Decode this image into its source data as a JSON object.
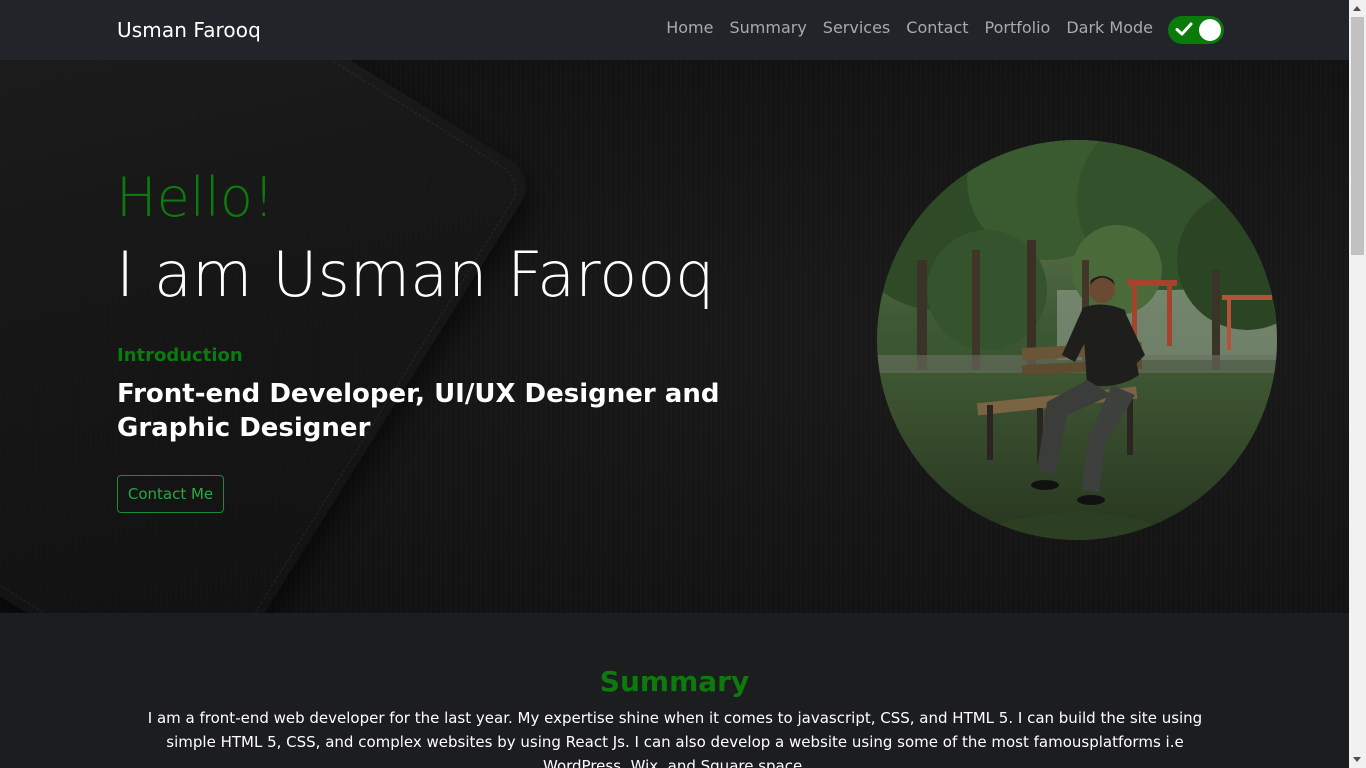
{
  "navbar": {
    "brand": "Usman Farooq",
    "links": [
      "Home",
      "Summary",
      "Services",
      "Contact",
      "Portfolio",
      "Dark Mode"
    ],
    "dark_mode_enabled": true,
    "accent_color": "#0a7a0a"
  },
  "hero": {
    "greeting": "Hello!",
    "name": "I am Usman Farooq",
    "intro_label": "Introduction",
    "role": "Front-end Developer, UI/UX Designer and Graphic Designer",
    "contact_button": "Contact Me",
    "avatar_icon": "profile-photo"
  },
  "summary": {
    "title": "Summary",
    "text": "I am a front-end web developer for the last year. My expertise shine when it comes to javascript, CSS, and HTML 5. I can build the site using simple HTML 5, CSS, and complex websites by using React Js. I can also develop a website using some of the most famousplatforms i.e WordPress, Wix, and Square space."
  },
  "colors": {
    "brand_green": "#0d7a0d",
    "button_green": "#28a745",
    "navbar_bg": "#212529",
    "page_bg": "#1c1d1f"
  }
}
